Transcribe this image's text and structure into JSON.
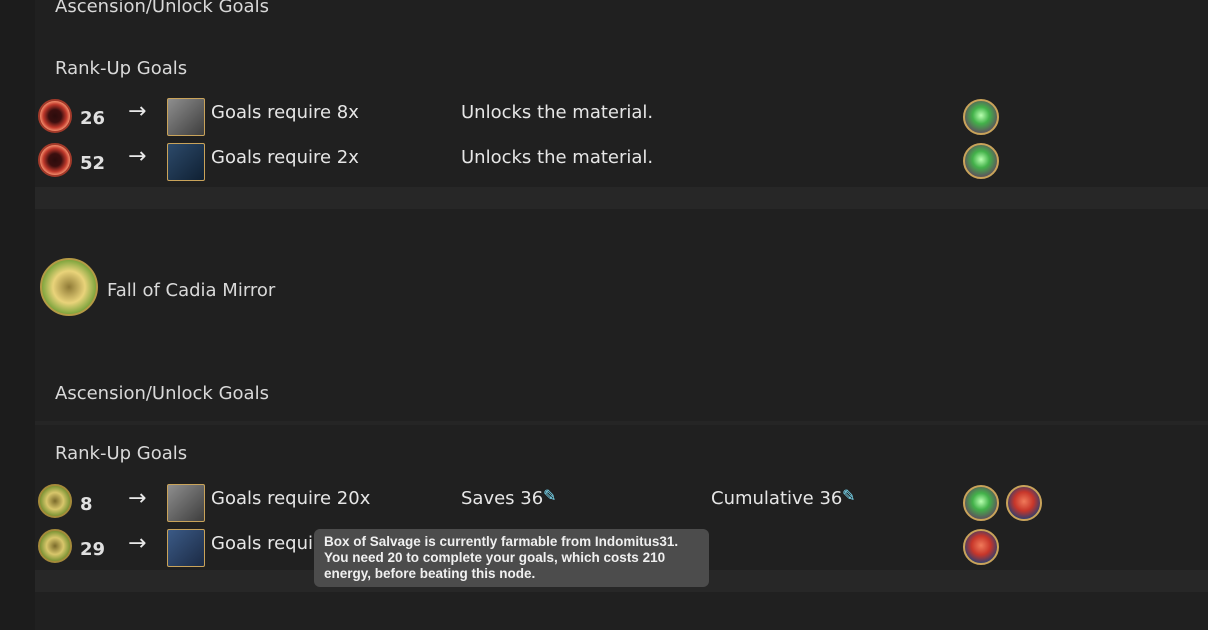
{
  "sections": [
    {
      "ascension_label": "Ascension/Unlock Goals",
      "rankup_label": "Rank-Up Goals",
      "rows": [
        {
          "rank": "26",
          "goal": "Goals require 8x",
          "unlock": "Unlocks the material."
        },
        {
          "rank": "52",
          "goal": "Goals require 2x",
          "unlock": "Unlocks the material."
        }
      ]
    },
    {
      "title": "Fall of Cadia Mirror",
      "ascension_label": "Ascension/Unlock Goals",
      "rankup_label": "Rank-Up Goals",
      "rows": [
        {
          "rank": "8",
          "goal": "Goals require 20x",
          "saves": "Saves 36",
          "cumulative": "Cumulative 36"
        },
        {
          "rank": "29",
          "goal": "Goals requir"
        }
      ]
    }
  ],
  "tooltip": {
    "text": "Box of Salvage is currently farmable from Indomitus31. You need 20 to complete your goals, which costs 210 energy, before beating this node."
  },
  "icons": {
    "arrow": "→",
    "energy_icon": "energy-vial-icon",
    "energy_color": "#7fe6ff"
  }
}
